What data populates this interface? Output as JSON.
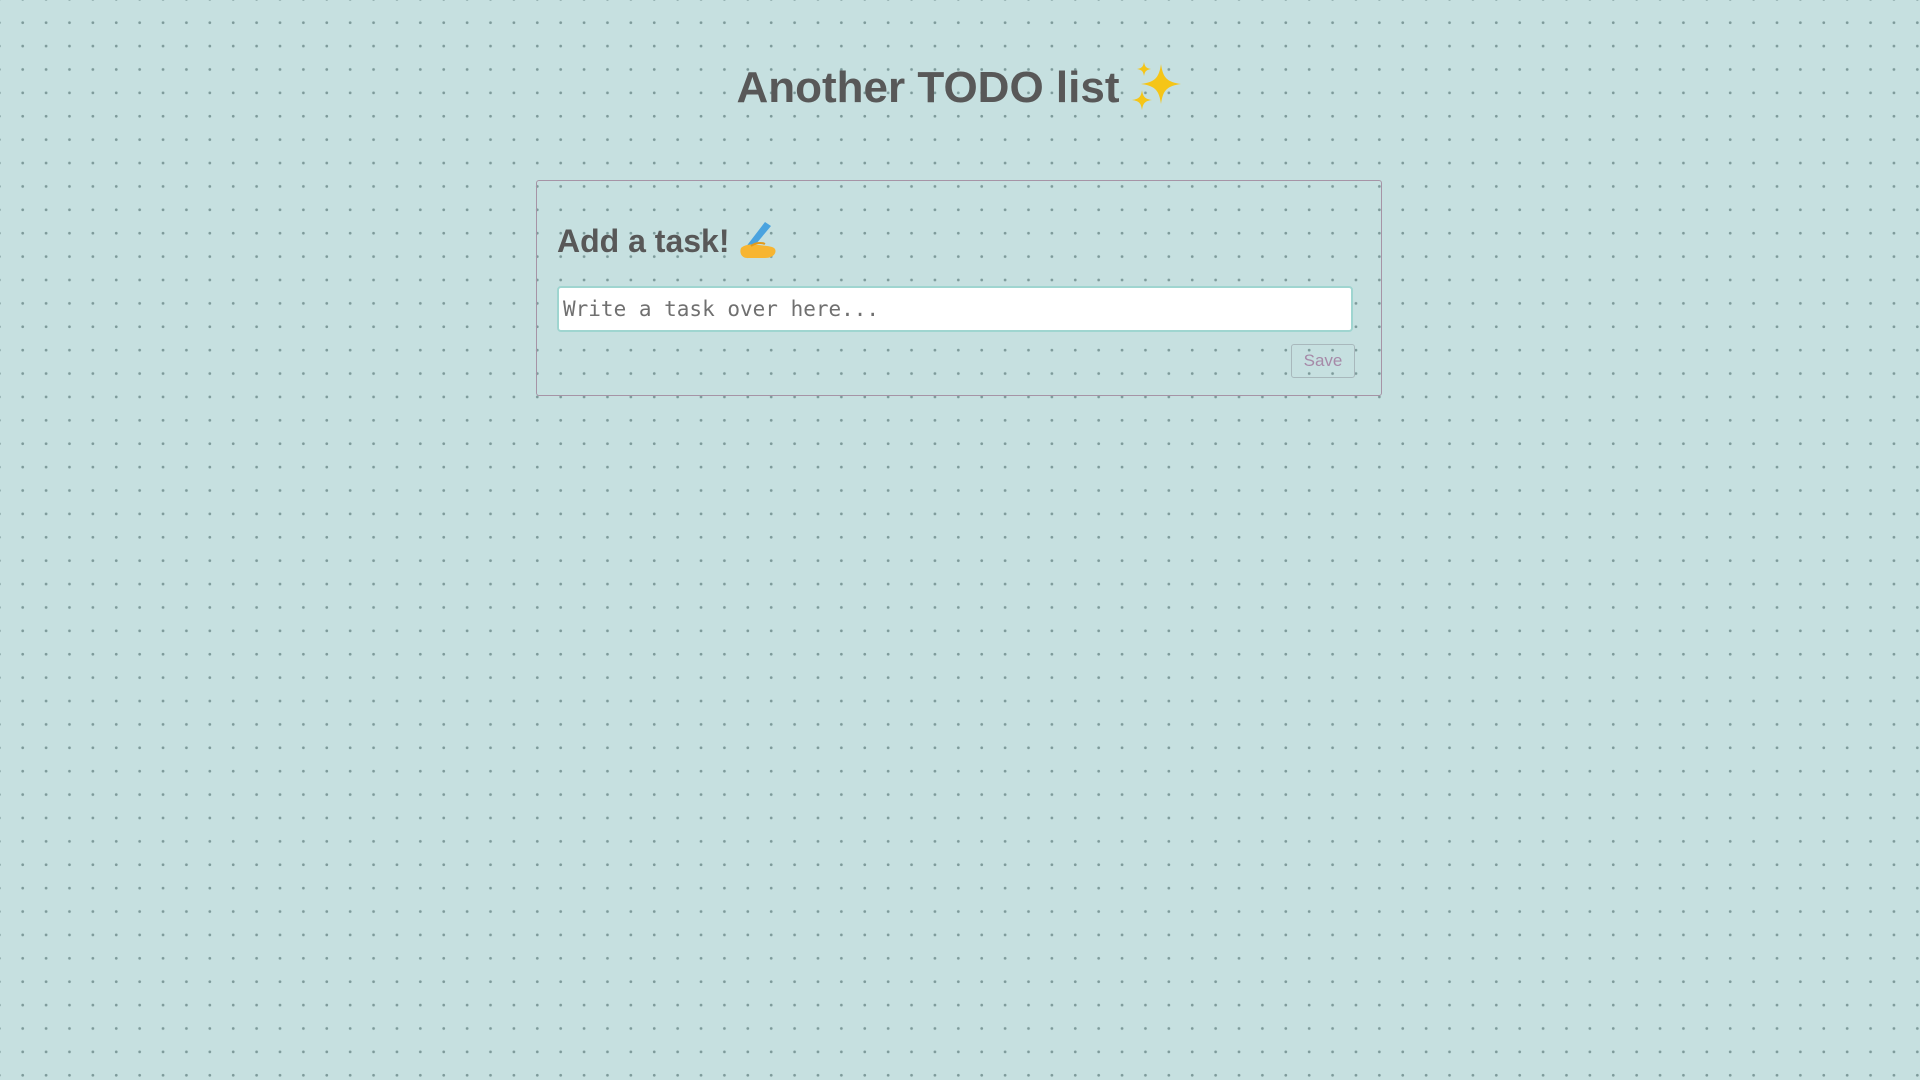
{
  "header": {
    "title": "Another TODO list",
    "title_icon": "sparkles-icon"
  },
  "add_task": {
    "heading": "Add a task!",
    "heading_icon": "writing-hand-icon",
    "input_value": "",
    "input_placeholder": "Write a task over here...",
    "save_label": "Save"
  },
  "colors": {
    "background": "#c6e0e0",
    "text": "#585858",
    "card_border": "#a694a6",
    "input_border": "#9fd5d0",
    "save_text": "#a68aa8",
    "sparkle": "#f5c518"
  }
}
